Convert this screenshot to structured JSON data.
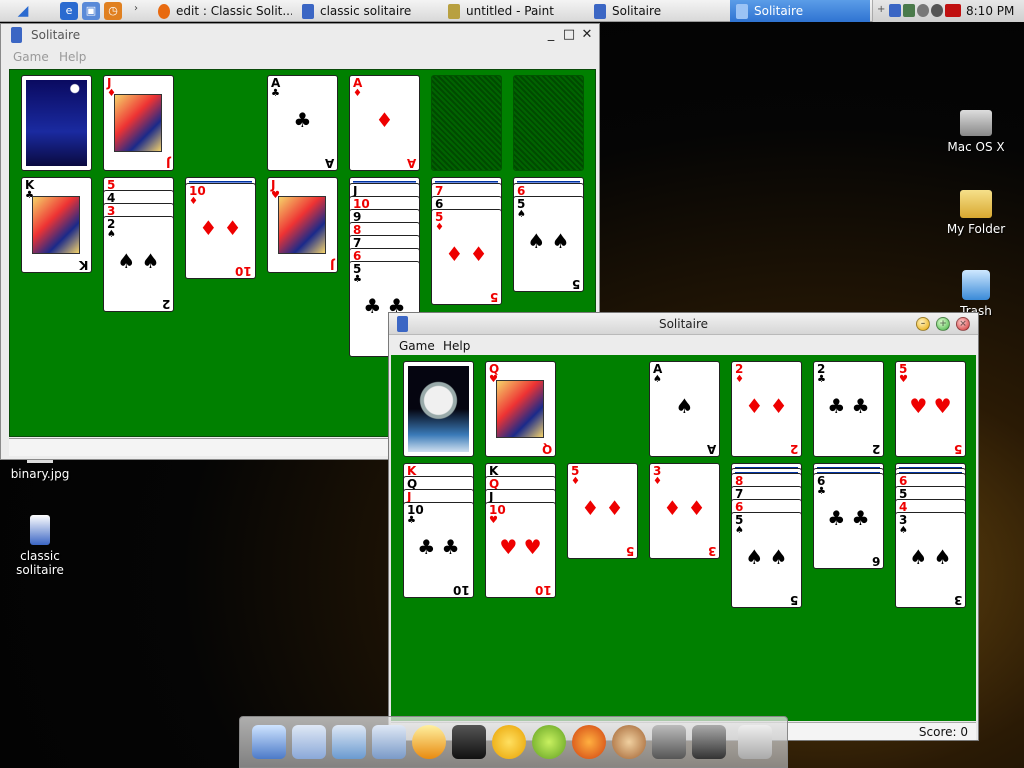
{
  "taskbar": {
    "tasks": [
      {
        "label": "edit : Classic Solit...",
        "active": false
      },
      {
        "label": "classic solitaire",
        "active": false
      },
      {
        "label": "untitled - Paint",
        "active": false
      },
      {
        "label": "Solitaire",
        "active": false
      },
      {
        "label": "Solitaire",
        "active": true
      }
    ],
    "clock": "8:10 PM"
  },
  "desktop": {
    "icons": [
      {
        "label": "Mac OS X"
      },
      {
        "label": "My Folder"
      },
      {
        "label": "Trash"
      },
      {
        "label": "binary.jpg"
      },
      {
        "label": "classic solitaire"
      }
    ]
  },
  "window_back": {
    "title": "Solitaire",
    "menu": [
      "Game",
      "Help"
    ],
    "controls": [
      "_",
      "□",
      "✕"
    ]
  },
  "window_front": {
    "title": "Solitaire",
    "menu": [
      "Game",
      "Help"
    ],
    "score_label": "Score: 0"
  },
  "colors": {
    "felt": "#008000",
    "red_suit": "#e00000",
    "taskbar_active": "#2f73d2"
  },
  "back_game": {
    "stock": "castle-back",
    "waste": {
      "rank": "J",
      "suit": "♦"
    },
    "foundations": [
      {
        "rank": "A",
        "suit": "♣"
      },
      {
        "rank": "A",
        "suit": "♦"
      },
      null,
      null
    ],
    "tableau": [
      {
        "hidden": 0,
        "visible": [
          {
            "rank": "K",
            "suit": "♣"
          }
        ]
      },
      {
        "hidden": 0,
        "visible": [
          {
            "rank": "5",
            "suit": "♥"
          },
          {
            "rank": "4",
            "suit": "♠"
          },
          {
            "rank": "3",
            "suit": "♥"
          },
          {
            "rank": "2",
            "suit": "♠"
          }
        ]
      },
      {
        "hidden": 1,
        "visible": [
          {
            "rank": "10",
            "suit": "♦"
          }
        ]
      },
      {
        "hidden": 0,
        "visible": [
          {
            "rank": "J",
            "suit": "♥"
          }
        ]
      },
      {
        "hidden": 1,
        "visible": [
          {
            "rank": "J",
            "suit": "♠"
          },
          {
            "rank": "10",
            "suit": "♥"
          },
          {
            "rank": "9",
            "suit": "♠"
          },
          {
            "rank": "8",
            "suit": "♥"
          },
          {
            "rank": "7",
            "suit": "♠"
          },
          {
            "rank": "6",
            "suit": "♥"
          },
          {
            "rank": "5",
            "suit": "♣"
          }
        ]
      },
      {
        "hidden": 1,
        "visible": [
          {
            "rank": "7",
            "suit": "♥"
          },
          {
            "rank": "6",
            "suit": "♠"
          },
          {
            "rank": "5",
            "suit": "♦"
          }
        ]
      },
      {
        "hidden": 1,
        "visible": [
          {
            "rank": "6",
            "suit": "♥"
          },
          {
            "rank": "5",
            "suit": "♠"
          }
        ]
      }
    ]
  },
  "front_game": {
    "stock": "astronaut-back",
    "waste": {
      "rank": "Q",
      "suit": "♥"
    },
    "foundations": [
      {
        "rank": "A",
        "suit": "♠"
      },
      {
        "rank": "2",
        "suit": "♦"
      },
      {
        "rank": "2",
        "suit": "♣"
      },
      {
        "rank": "5",
        "suit": "♥"
      }
    ],
    "tableau": [
      {
        "hidden": 0,
        "visible": [
          {
            "rank": "K",
            "suit": "♥"
          },
          {
            "rank": "Q",
            "suit": "♠"
          },
          {
            "rank": "J",
            "suit": "♥"
          },
          {
            "rank": "10",
            "suit": "♣"
          }
        ]
      },
      {
        "hidden": 0,
        "visible": [
          {
            "rank": "K",
            "suit": "♠"
          },
          {
            "rank": "Q",
            "suit": "♦"
          },
          {
            "rank": "J",
            "suit": "♠"
          },
          {
            "rank": "10",
            "suit": "♥"
          }
        ]
      },
      {
        "hidden": 0,
        "visible": [
          {
            "rank": "5",
            "suit": "♦"
          }
        ]
      },
      {
        "hidden": 0,
        "visible": [
          {
            "rank": "3",
            "suit": "♦"
          }
        ]
      },
      {
        "hidden": 2,
        "visible": [
          {
            "rank": "8",
            "suit": "♥"
          },
          {
            "rank": "7",
            "suit": "♠"
          },
          {
            "rank": "6",
            "suit": "♥"
          },
          {
            "rank": "5",
            "suit": "♠"
          }
        ]
      },
      {
        "hidden": 2,
        "visible": [
          {
            "rank": "6",
            "suit": "♣"
          }
        ]
      },
      {
        "hidden": 2,
        "visible": [
          {
            "rank": "6",
            "suit": "♥"
          },
          {
            "rank": "5",
            "suit": "♠"
          },
          {
            "rank": "4",
            "suit": "♥"
          },
          {
            "rank": "3",
            "suit": "♠"
          }
        ]
      }
    ]
  }
}
